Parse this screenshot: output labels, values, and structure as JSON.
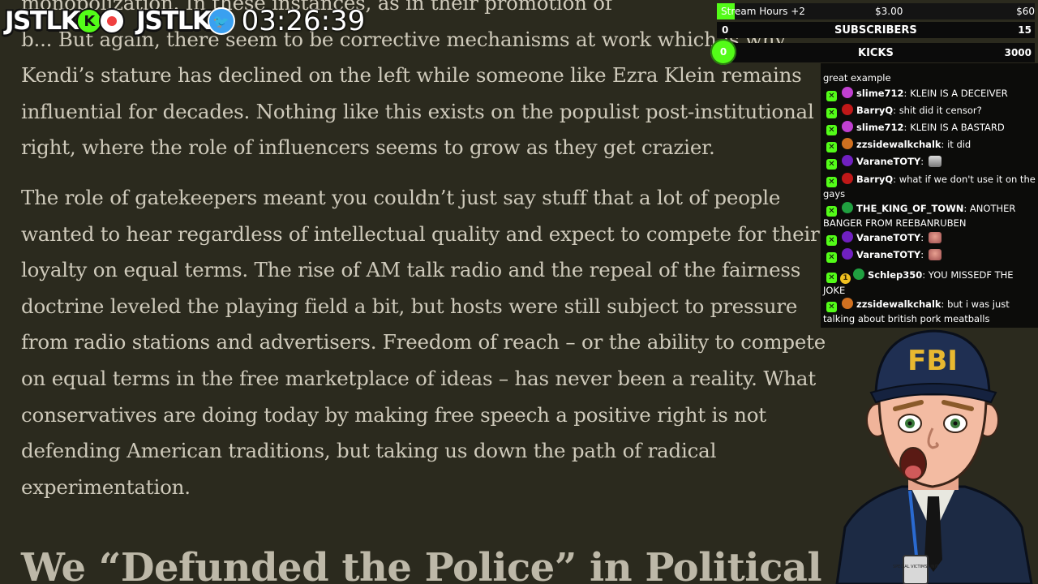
{
  "article": {
    "paragraph1": [
      "monopolization. In these instances, as in their promotion of",
      "b... But again, there seem to be corrective mechanisms at work which is why",
      "Kendi’s stature has declined on the left while someone like Ezra Klein remains",
      "influential for decades. Nothing like this exists on the populist post-institutional",
      "right, where the role of influencers seems to grow as they get crazier."
    ],
    "paragraph2": [
      "The role of gatekeepers meant you couldn’t just say stuff that a lot of people",
      "wanted to hear regardless of intellectual quality and expect to compete for their",
      "loyalty on equal terms. The rise of AM talk radio and the repeal of the fairness",
      "doctrine leveled the playing field a bit, but hosts were still subject to pressure",
      "from radio stations and advertisers. Freedom of reach – or the ability to compete",
      "on equal terms in the free marketplace of ideas – has never been a reality. What",
      "conservatives are doing today by making free speech a positive right is not",
      "defending American traditions, but taking us down the path of radical",
      "experimentation."
    ],
    "heading": "We “Defunded the Police” in Political"
  },
  "overlay": {
    "logo1": "JSTLK",
    "kick_badge": "K",
    "logo2": "JSTLK",
    "twitter_glyph": "🐦",
    "timer": "03:26:39"
  },
  "stats": {
    "stream_hours_label": "Stream Hours +2",
    "stream_hours_amount": "$3.00",
    "stream_hours_goal": "$60",
    "subs_current": "0",
    "subs_label": "SUBSCRIBERS",
    "subs_goal": "15",
    "kicks_current": "0",
    "kicks_label": "KICKS",
    "kicks_goal": "3000"
  },
  "chat": {
    "messages": [
      {
        "user": "",
        "text": "great example"
      },
      {
        "user": "slime712",
        "text": "KLEIN IS A DECEIVER",
        "color": "#c040d0"
      },
      {
        "user": "BarryQ",
        "text": "shit did it censor?",
        "color": "#c01818"
      },
      {
        "user": "slime712",
        "text": "KLEIN IS A BASTARD",
        "color": "#c040d0"
      },
      {
        "user": "zzsidewalkchalk",
        "text": "it did",
        "color": "#d07020"
      },
      {
        "user": "VaraneTOTY",
        "text": "",
        "color": "#7020c0"
      },
      {
        "user": "BarryQ",
        "text": "what if we don't use it on the gays",
        "color": "#c01818"
      },
      {
        "user": "THE_KING_OF_TOWN",
        "text": "ANOTHER BANGER FROM REEBANRUBEN",
        "color": "#20a040"
      },
      {
        "user": "VaraneTOTY",
        "text": "",
        "color": "#7020c0"
      },
      {
        "user": "VaraneTOTY",
        "text": "",
        "color": "#7020c0"
      },
      {
        "user": "Schlep350",
        "text": "YOU MISSEDF THE JOKE",
        "color": "#20a040",
        "sub_badge": "1"
      },
      {
        "user": "zzsidewalkchalk",
        "text": "but i was just talking about british pork meatballs",
        "color": "#d07020"
      }
    ],
    "mod_glyph": "✕"
  },
  "avatar": {
    "cap_text": "FBI",
    "badge_text": "SPECIAL VICTIMS UNIT"
  },
  "colors": {
    "page_bg": "#2b2a1e",
    "text": "#cfcabb",
    "kick_green": "#53fc18",
    "chat_bg": "#080808"
  }
}
